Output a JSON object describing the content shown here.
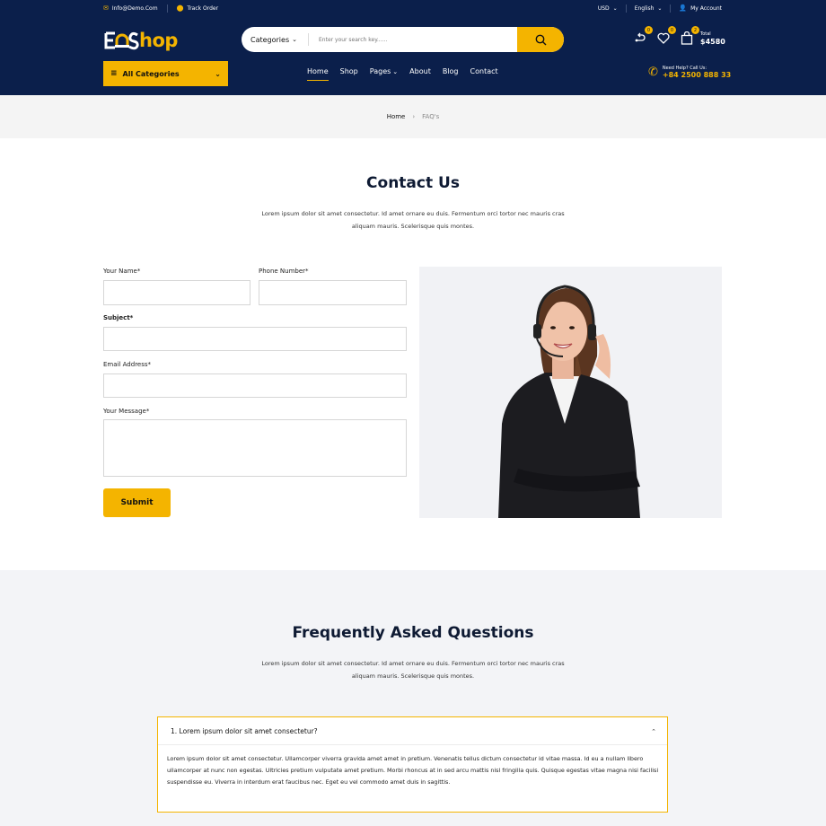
{
  "topbar": {
    "email": "Info@Demo.Com",
    "track_order": "Track Order",
    "currency": "USD",
    "language": "English",
    "account": "My Account"
  },
  "logo": {
    "text": "hop"
  },
  "search": {
    "category": "Categories",
    "placeholder": "Enter your search key......"
  },
  "header_icons": {
    "compare_count": "0",
    "wishlist_count": "0",
    "cart_count": "2",
    "total_label": "Total",
    "total_amount": "$4580"
  },
  "all_categories": "All Categories",
  "nav": [
    "Home",
    "Shop",
    "Pages",
    "About",
    "Blog",
    "Contact"
  ],
  "help": {
    "label": "Need Help? Call Us:",
    "phone": "+84 2500 888 33"
  },
  "breadcrumb": {
    "home": "Home",
    "current": "FAQ's"
  },
  "contact": {
    "title": "Contact Us",
    "desc": "Lorem ipsum dolor sit amet consectetur. Id amet ornare eu duis. Fermentum orci tortor nec mauris cras aliquam mauris. Scelerisque quis montes.",
    "name_label": "Your Name*",
    "phone_label": "Phone Number*",
    "subject_label": "Subject*",
    "email_label": "Email Address*",
    "message_label": "Your Message*",
    "submit": "Submit"
  },
  "faq": {
    "title": "Frequently Asked Questions",
    "desc": "Lorem ipsum dolor sit amet consectetur. Id amet ornare eu duis. Fermentum orci tortor nec mauris cras aliquam mauris. Scelerisque quis montes.",
    "items": [
      {
        "question": "1. Lorem ipsum dolor sit amet consectetur?",
        "answer": "Lorem ipsum dolor sit amet consectetur. Ullamcorper viverra gravida amet amet in pretium. Venenatis tellus dictum consectetur id vitae massa. Id eu a nullam libero ullamcorper at nunc non egestas. Ultricies pretium vulputate amet pretium. Morbi rhoncus at in sed arcu mattis nisl fringilla quis. Quisque egestas vitae magna nisi facilisi suspendisse eu. Viverra in interdum erat faucibus nec. Eget eu vel commodo amet duis in sagittis."
      }
    ]
  },
  "colors": {
    "navy": "#0b1f4b",
    "accent": "#f4b400"
  }
}
